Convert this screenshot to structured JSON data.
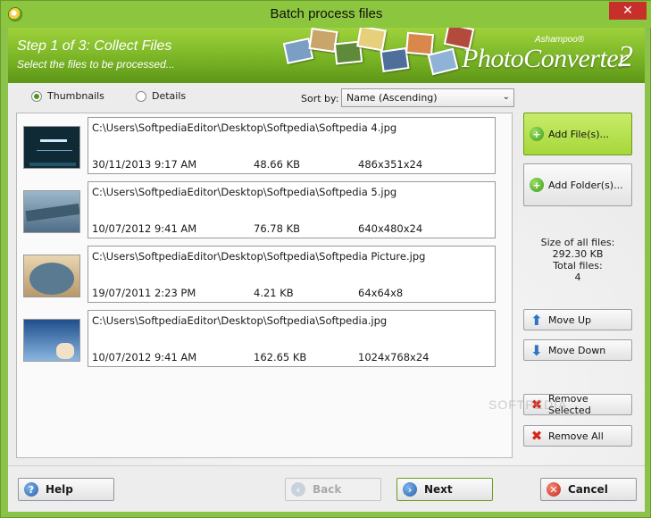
{
  "window": {
    "title": "Batch process files",
    "close_glyph": "✕"
  },
  "banner": {
    "step": "Step 1 of 3: Collect Files",
    "subtitle": "Select the files to be processed...",
    "brand_small": "Ashampoo®",
    "brand_name": "PhotoConverter",
    "brand_version": "2"
  },
  "view": {
    "thumbnails_label": "Thumbnails",
    "details_label": "Details",
    "selected": "Thumbnails"
  },
  "sort": {
    "label": "Sort by:",
    "value": "Name (Ascending)"
  },
  "files": [
    {
      "path": "C:\\Users\\SoftpediaEditor\\Desktop\\Softpedia\\Softpedia 4.jpg",
      "date": "30/11/2013 9:17 AM",
      "size": "48.66 KB",
      "dims": "486x351x24"
    },
    {
      "path": "C:\\Users\\SoftpediaEditor\\Desktop\\Softpedia\\Softpedia 5.jpg",
      "date": "10/07/2012 9:41 AM",
      "size": "76.78 KB",
      "dims": "640x480x24"
    },
    {
      "path": "C:\\Users\\SoftpediaEditor\\Desktop\\Softpedia\\Softpedia Picture.jpg",
      "date": "19/07/2011 2:23 PM",
      "size": "4.21 KB",
      "dims": "64x64x8"
    },
    {
      "path": "C:\\Users\\SoftpediaEditor\\Desktop\\Softpedia\\Softpedia.jpg",
      "date": "10/07/2012 9:41 AM",
      "size": "162.65 KB",
      "dims": "1024x768x24"
    }
  ],
  "actions": {
    "add_files": "Add File(s)...",
    "add_folder": "Add Folder(s)...",
    "move_up": "Move Up",
    "move_down": "Move Down",
    "remove_selected": "Remove Selected",
    "remove_all": "Remove All"
  },
  "summary": {
    "size_label": "Size of all files:",
    "size_value": "292.30 KB",
    "count_label": "Total files:",
    "count_value": "4"
  },
  "footer": {
    "help": "Help",
    "back": "Back",
    "next": "Next",
    "cancel": "Cancel"
  },
  "watermark": "SOFTPEDIA",
  "colors": {
    "accent": "#8cc63e",
    "banner": "#7ab526"
  }
}
